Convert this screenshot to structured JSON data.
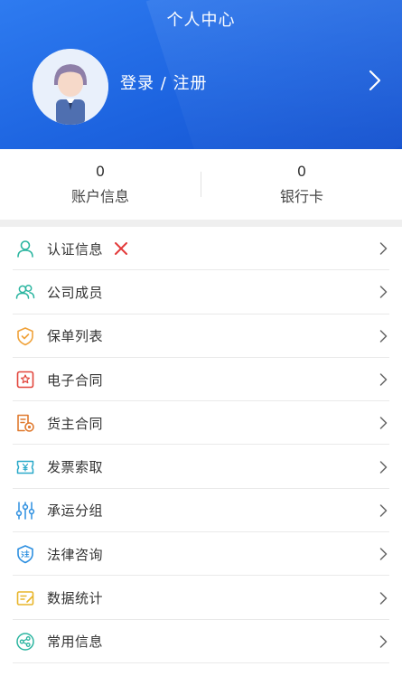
{
  "header": {
    "title": "个人中心",
    "login_label": "登录 / 注册",
    "background_color": "#1d64e0"
  },
  "stats": [
    {
      "value": "0",
      "label": "账户信息"
    },
    {
      "value": "0",
      "label": "银行卡"
    }
  ],
  "menu": [
    {
      "label": "认证信息",
      "icon": "user-icon",
      "icon_color": "#2bb5a0",
      "status_icon": "red-x-icon",
      "status_color": "#e33b3b"
    },
    {
      "label": "公司成员",
      "icon": "users-icon",
      "icon_color": "#2bb5a0"
    },
    {
      "label": "保单列表",
      "icon": "shield-check-icon",
      "icon_color": "#f0a23a"
    },
    {
      "label": "电子合同",
      "icon": "seal-contract-icon",
      "icon_color": "#e2453c"
    },
    {
      "label": "货主合同",
      "icon": "document-stamp-icon",
      "icon_color": "#e07a2e"
    },
    {
      "label": "发票索取",
      "icon": "invoice-icon",
      "icon_color": "#2aa9c9"
    },
    {
      "label": "承运分组",
      "icon": "sliders-icon",
      "icon_color": "#2d8fe0"
    },
    {
      "label": "法律咨询",
      "icon": "law-shield-icon",
      "icon_color": "#2d8fe0"
    },
    {
      "label": "数据统计",
      "icon": "data-note-icon",
      "icon_color": "#e8b52a"
    },
    {
      "label": "常用信息",
      "icon": "share-icon",
      "icon_color": "#2bb5a0"
    }
  ]
}
